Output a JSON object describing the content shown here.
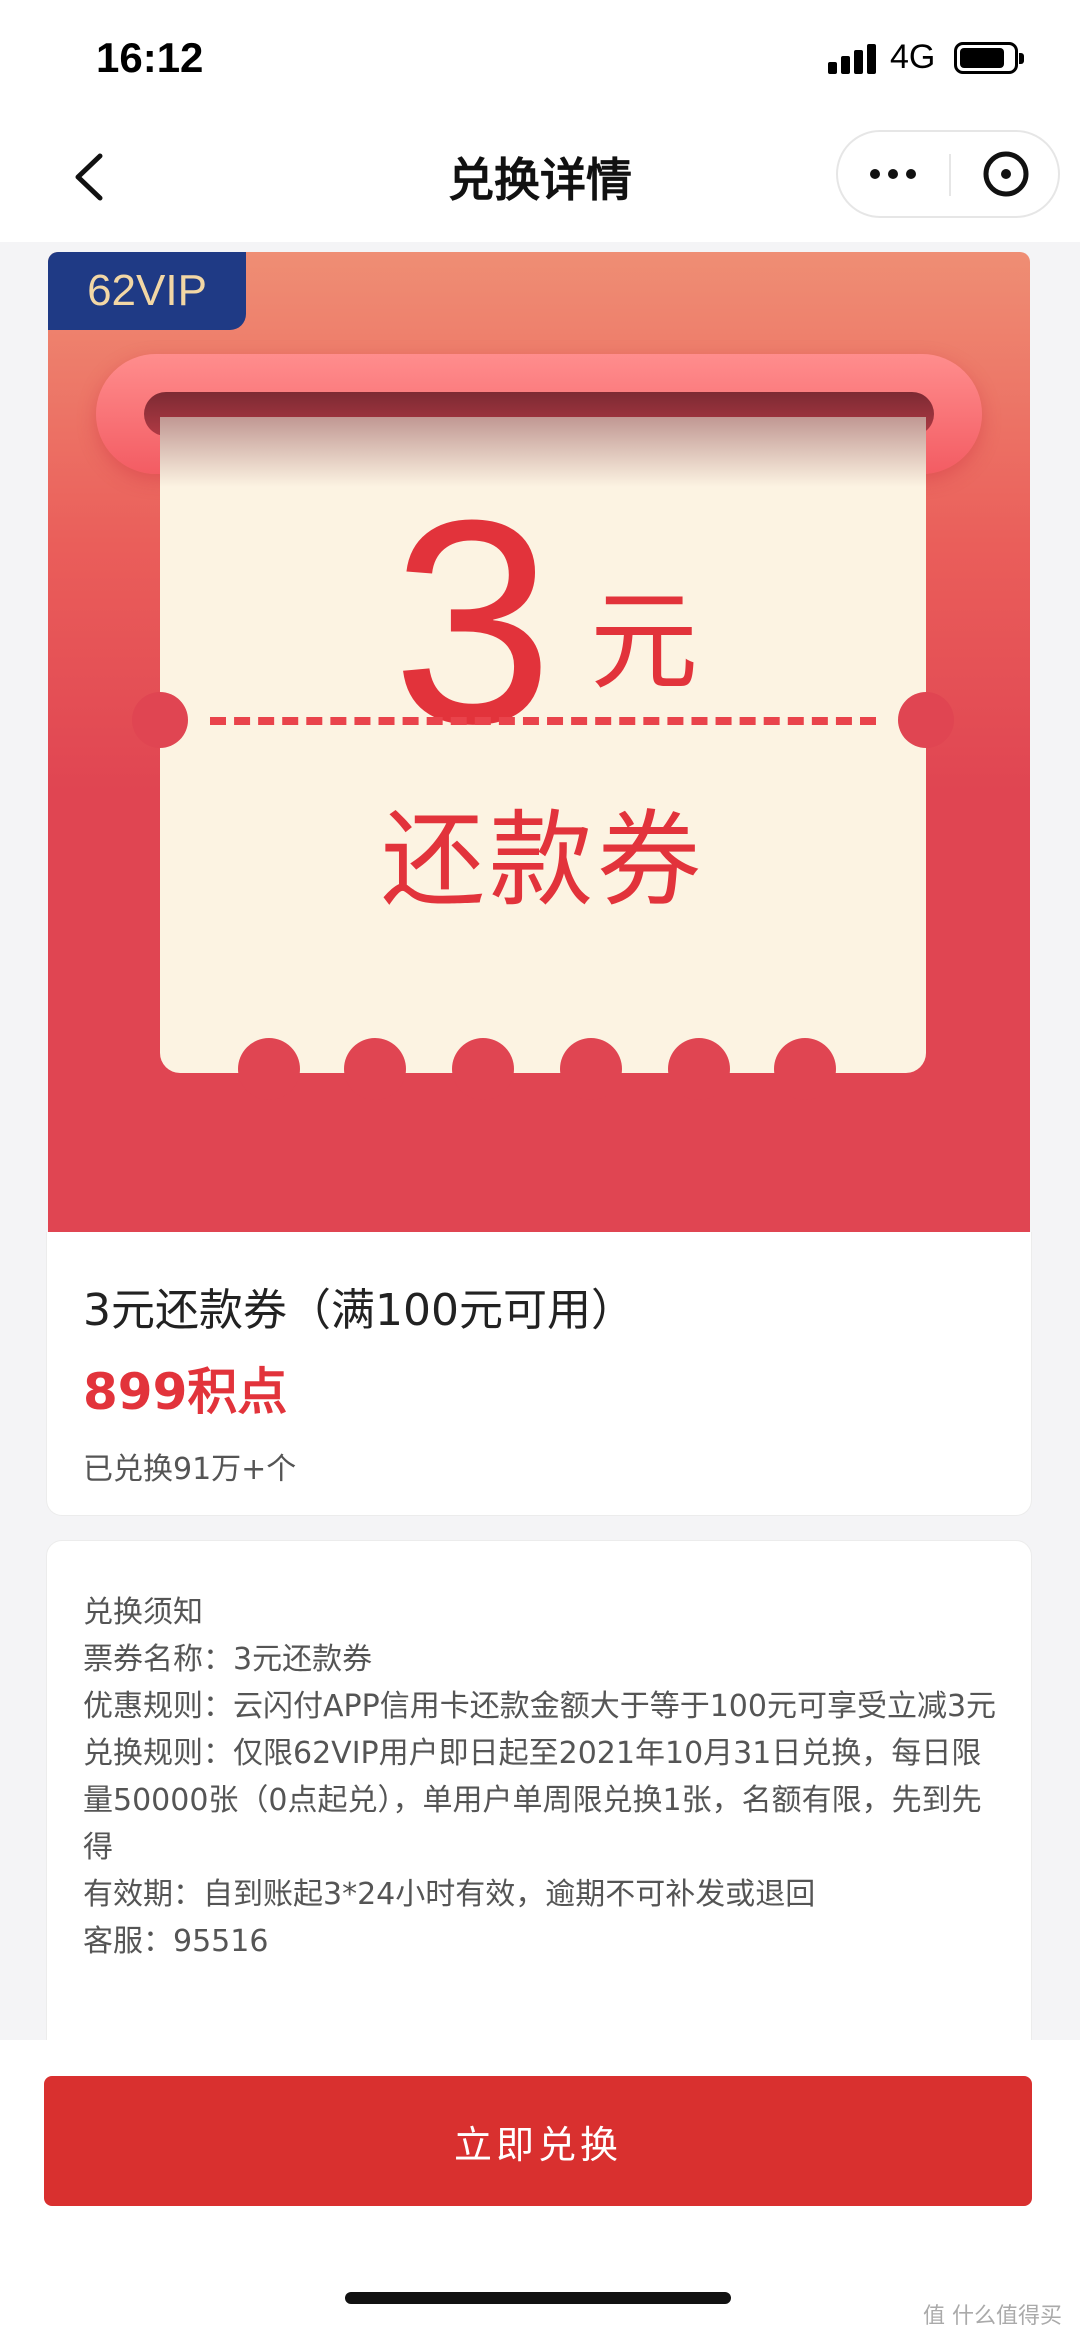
{
  "status_bar": {
    "time": "16:12",
    "network": "4G",
    "battery_level": 0.85,
    "icons": [
      "signal-icon",
      "battery-icon"
    ]
  },
  "nav": {
    "title": "兑换详情",
    "icons": [
      "back-arrow-icon",
      "more-dots-icon",
      "close-circle-icon"
    ]
  },
  "banner": {
    "vip_tag": "62VIP",
    "amount": "3",
    "unit": "元",
    "ticket_label": "还款券",
    "colors": {
      "primary": "#e2333b",
      "banner_bg": "#e04552",
      "ticket_bg": "#fcf3e2",
      "vip_bg": "#1f3a85",
      "vip_text": "#f2d7a5"
    }
  },
  "product": {
    "name": "3元还款券（满100元可用）",
    "price": "899积点",
    "sold": "已兑换91万+个"
  },
  "notice": {
    "heading": "兑换须知",
    "ticket_name": "票券名称：3元还款券",
    "discount_rule": "优惠规则：云闪付APP信用卡还款金额大于等于100元可享受立减3元",
    "exchange_rule": "兑换规则：仅限62VIP用户即日起至2021年10月31日兑换，每日限量50000张（0点起兑），单用户单周限兑换1张，名额有限，先到先得",
    "validity": "有效期：自到账起3*24小时有效，逾期不可补发或退回",
    "service": "客服：95516"
  },
  "bottom": {
    "redeem_label": "立即兑换",
    "button_color": "#d9302f",
    "watermark": "值 什么值得买"
  }
}
